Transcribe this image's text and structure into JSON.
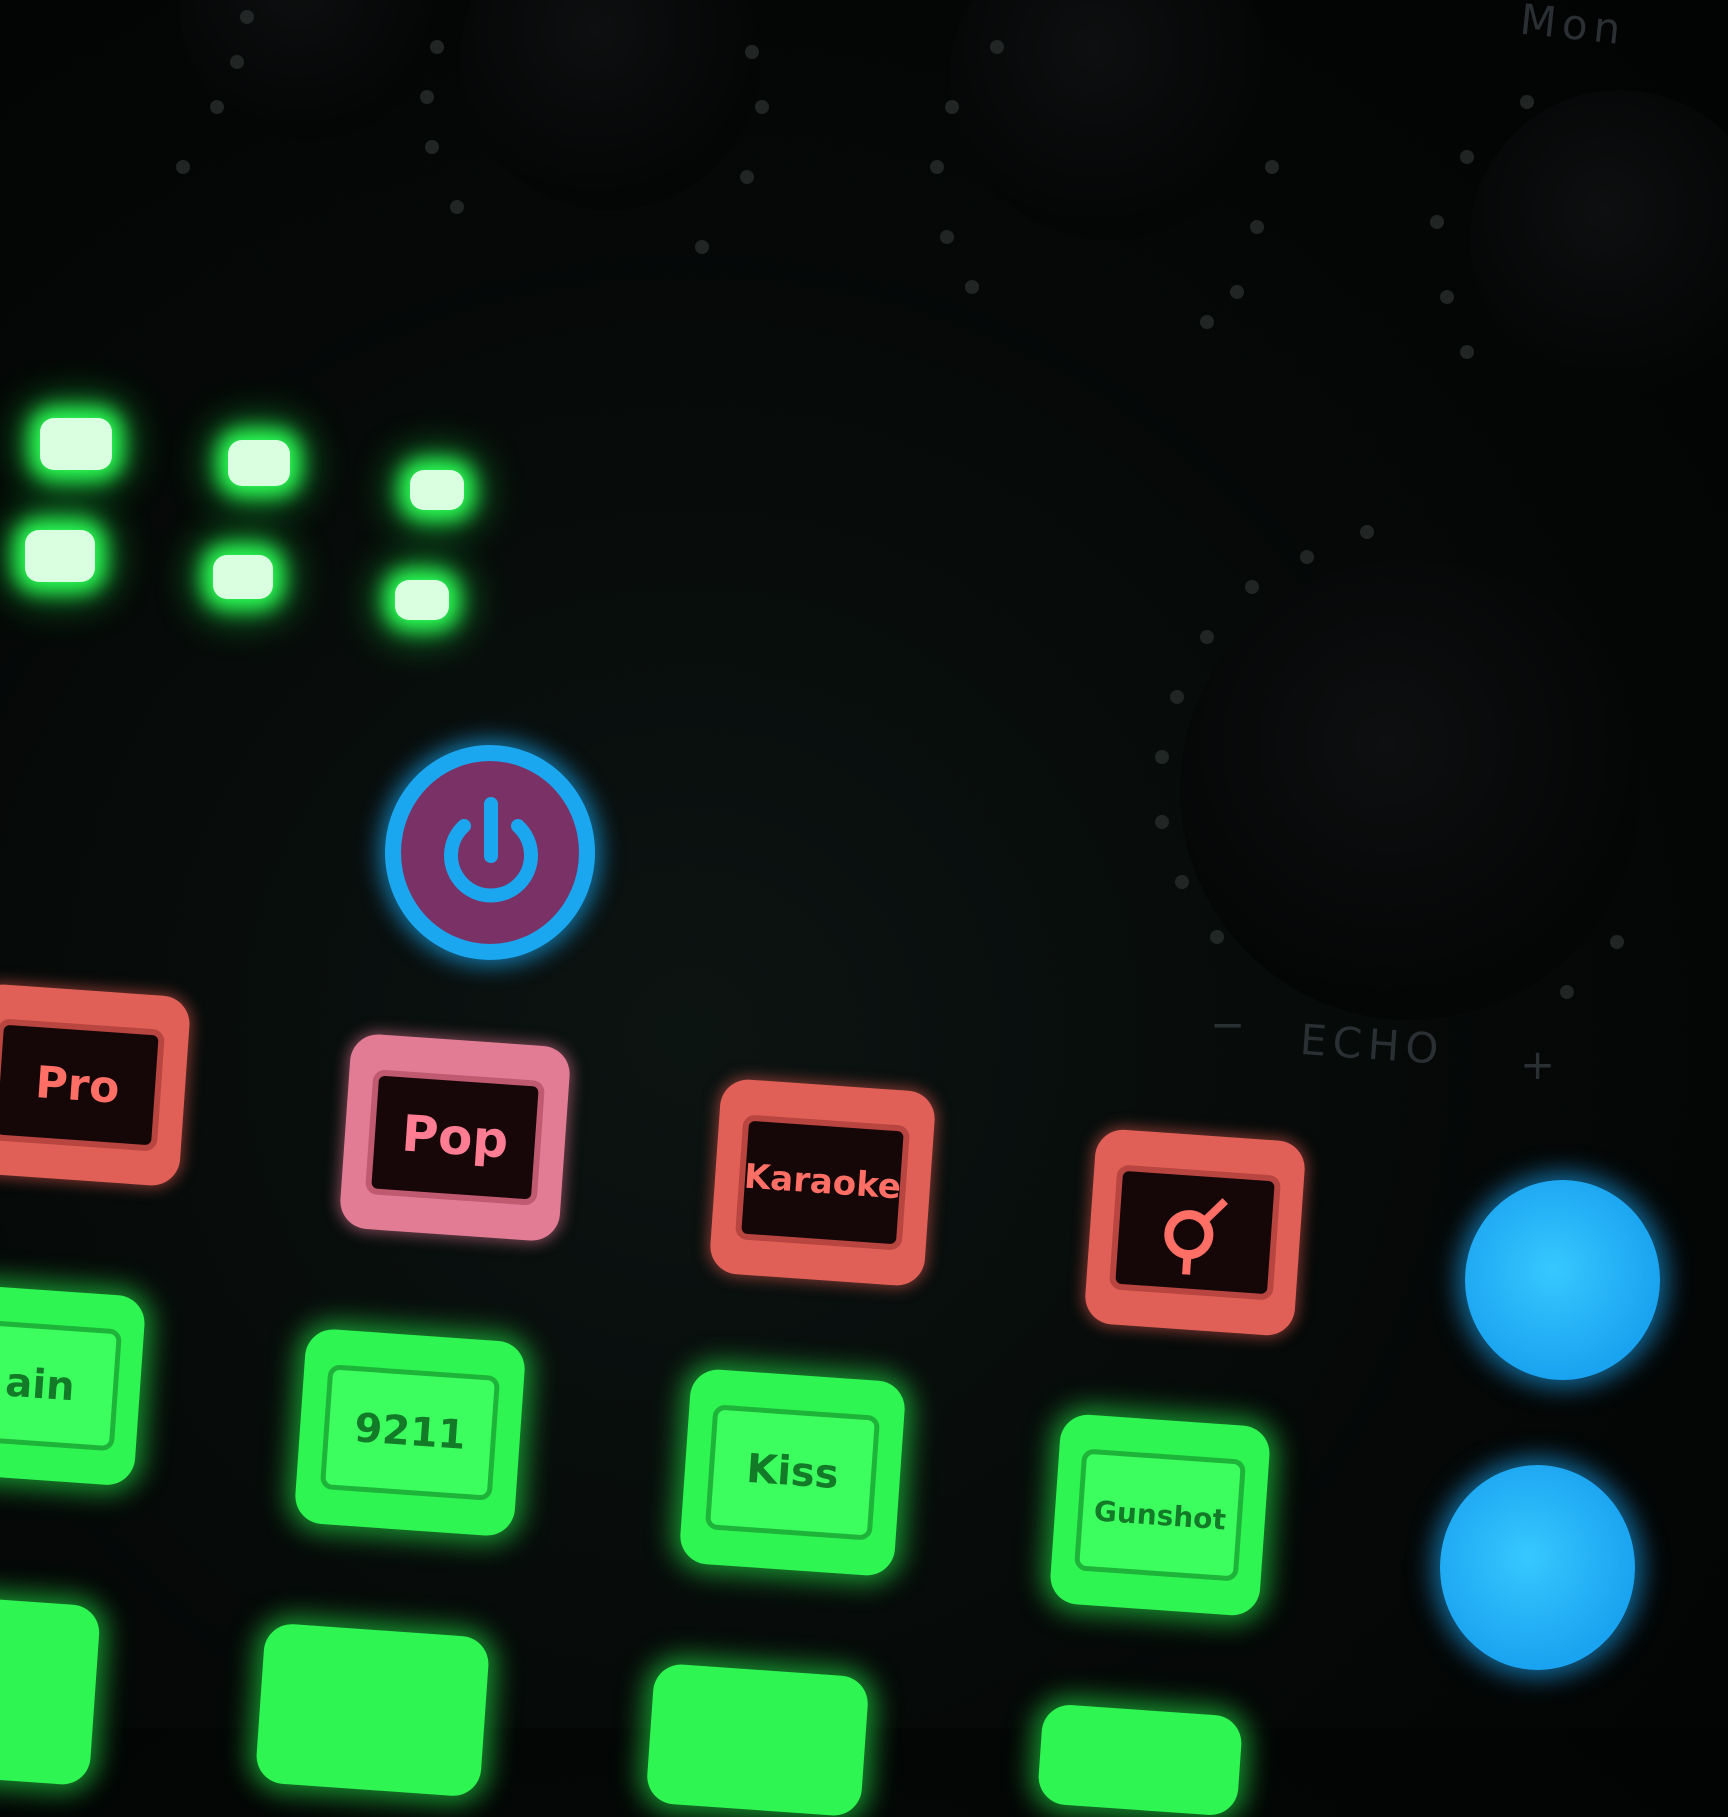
{
  "device": {
    "echo_label": "ECHO",
    "echo_minus": "−",
    "echo_plus": "+",
    "corner_label": "Mon"
  },
  "effect_buttons": {
    "row1": [
      "Pro",
      "Pop",
      "Karaoke",
      ""
    ],
    "row2": [
      "ain",
      "9211",
      "Kiss",
      "Gunshot"
    ]
  },
  "colors": {
    "led_green": "#2cff55",
    "power_ring": "#1aa7f0",
    "power_fill": "#7a3266",
    "key_red": "#e06058",
    "key_pink": "#e27c95",
    "key_green": "#2ef552",
    "button_blue": "#1aa3f0"
  },
  "icons": {
    "power": "power-icon",
    "gender_swap": "gender-symbol-icon"
  }
}
